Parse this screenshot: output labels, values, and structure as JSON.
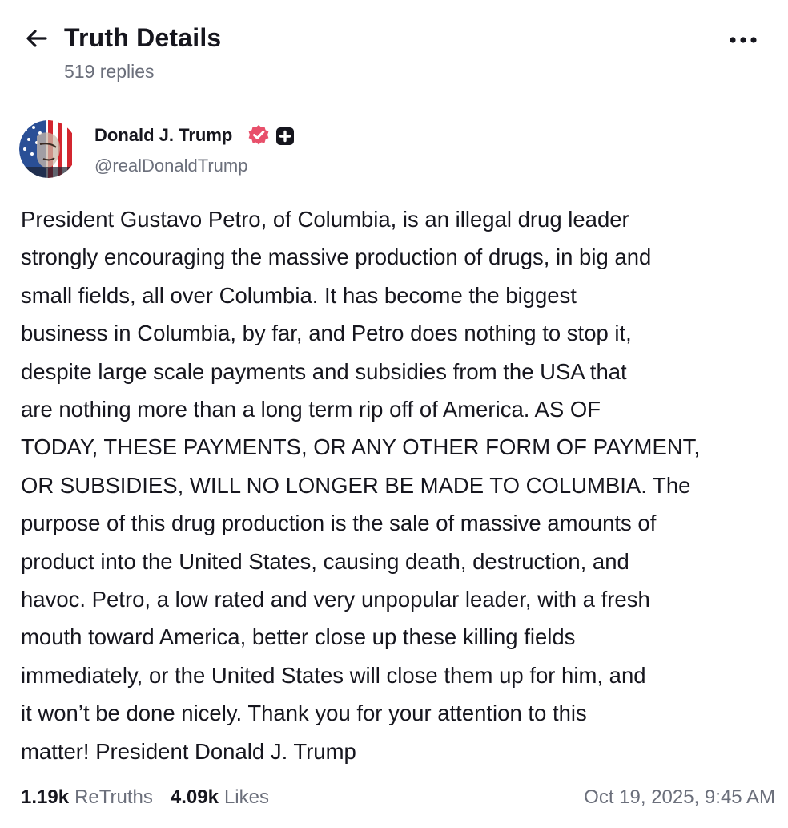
{
  "header": {
    "title": "Truth Details",
    "replies": "519 replies",
    "back_icon": "arrow-left-icon",
    "more_icon": "more-horizontal-icon"
  },
  "post": {
    "author": {
      "name": "Donald J. Trump",
      "handle": "@realDonaldTrump",
      "verified_icon": "verified-check-icon",
      "verified_color": "#e8506b",
      "plus_icon": "plus-square-icon"
    },
    "body_lines": [
      "President Gustavo Petro, of Columbia, is an illegal drug leader",
      "strongly encouraging the massive production of drugs, in big and",
      "small fields, all over Columbia. It has become the biggest",
      "business in Columbia, by far, and Petro does nothing to stop it,",
      "despite large scale payments and subsidies from the USA that",
      "are nothing more than a long term rip off of America. AS OF",
      "TODAY, THESE PAYMENTS, OR ANY OTHER FORM OF PAYMENT,",
      "OR SUBSIDIES, WILL NO LONGER BE MADE TO COLUMBIA. The",
      "purpose of this drug production is the sale of massive amounts of",
      "product into the United States, causing death, destruction, and",
      "havoc. Petro, a low rated and very unpopular leader, with a fresh",
      "mouth toward America, better close up these killing fields",
      "immediately, or the United States will close them up for him, and",
      "it won’t be done nicely. Thank you for your attention to this",
      "matter! President Donald J. Trump"
    ],
    "stats": {
      "retruths_count": "1.19k",
      "retruths_label": "ReTruths",
      "likes_count": "4.09k",
      "likes_label": "Likes"
    },
    "timestamp": "Oct 19, 2025, 9:45 AM"
  },
  "colors": {
    "text_primary": "#16161e",
    "text_secondary": "#6b6f7b",
    "background": "#ffffff"
  }
}
